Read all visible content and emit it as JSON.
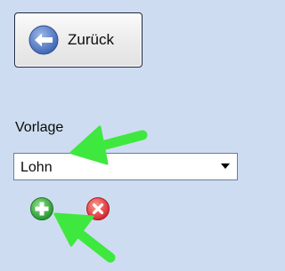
{
  "back_button": {
    "label": "Zurück",
    "icon": "back-arrow-icon"
  },
  "template": {
    "label": "Vorlage",
    "selected": "Lohn",
    "dropdown_icon": "chevron-down-icon"
  },
  "actions": {
    "add_icon": "plus-icon",
    "delete_icon": "close-icon"
  },
  "colors": {
    "background": "#cddcf0",
    "annotation_arrow": "#3ee83e",
    "add_button": "#2fa83a",
    "delete_button": "#e0303a",
    "back_icon": "#4b72bd"
  }
}
